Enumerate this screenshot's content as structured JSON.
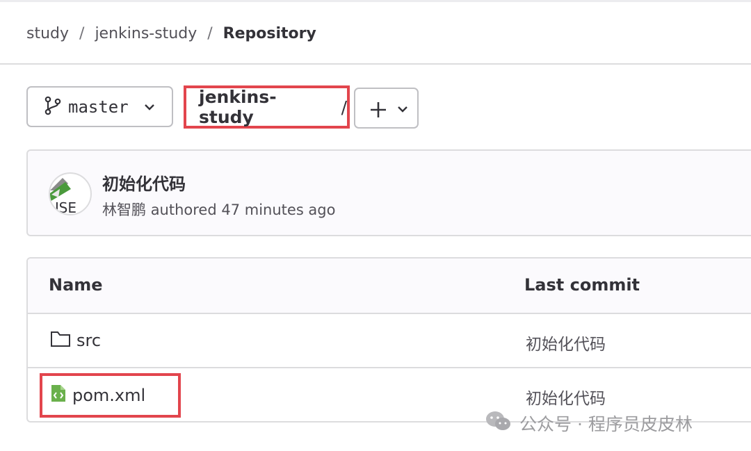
{
  "breadcrumb": {
    "items": [
      "study",
      "jenkins-study"
    ],
    "separator": "/",
    "current": "Repository"
  },
  "branch": {
    "name": "master",
    "icon": "git-branch-icon"
  },
  "path": {
    "root": "jenkins-study",
    "separator": "/"
  },
  "add_menu": {
    "icon": "plus-icon"
  },
  "last_commit": {
    "title": "初始化代码",
    "author": "林智鹏",
    "meta": "authored 47 minutes ago",
    "avatar_text": "USE"
  },
  "table": {
    "columns": [
      "Name",
      "Last commit"
    ],
    "rows": [
      {
        "name": "src",
        "icon": "folder-icon",
        "commit": "初始化代码"
      },
      {
        "name": "pom.xml",
        "icon": "xml-file-icon",
        "commit": "初始化代码"
      }
    ]
  },
  "watermark": {
    "text": "公众号 · 程序员皮皮林"
  },
  "colors": {
    "highlight": "#e2454d",
    "file_icon": "#6ab04c",
    "border": "#dcdcde"
  }
}
